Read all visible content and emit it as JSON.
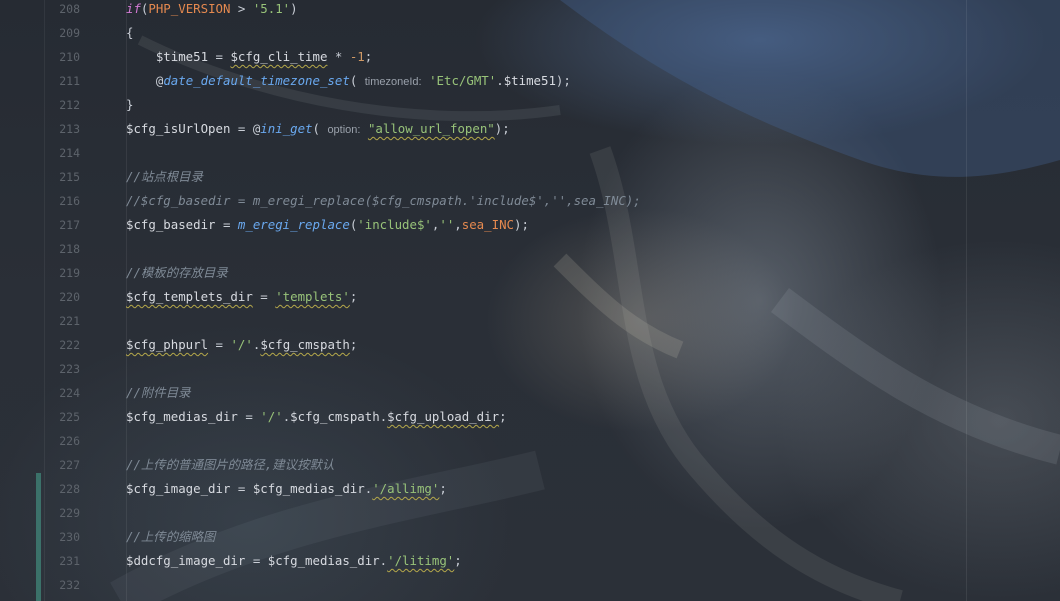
{
  "editor": {
    "accent_vcs_color": "#3e7c72",
    "lines": [
      {
        "num": "208",
        "segments": [
          {
            "t": "if",
            "c": "kw"
          },
          {
            "t": "(",
            "c": "op"
          },
          {
            "t": "PHP_VERSION",
            "c": "const"
          },
          {
            "t": " > ",
            "c": "op"
          },
          {
            "t": "'5.1'",
            "c": "str"
          },
          {
            "t": ")",
            "c": "op"
          }
        ]
      },
      {
        "num": "209",
        "segments": [
          {
            "t": "{",
            "c": "op"
          }
        ]
      },
      {
        "num": "210",
        "segments": [
          {
            "t": "    $time51",
            "c": "var"
          },
          {
            "t": " = ",
            "c": "op"
          },
          {
            "t": "$cfg_cli_time",
            "c": "var warn"
          },
          {
            "t": " * ",
            "c": "op"
          },
          {
            "t": "-1",
            "c": "num"
          },
          {
            "t": ";",
            "c": "op"
          }
        ]
      },
      {
        "num": "211",
        "segments": [
          {
            "t": "    @",
            "c": "op"
          },
          {
            "t": "date_default_timezone_set",
            "c": "fn"
          },
          {
            "t": "( ",
            "c": "op"
          },
          {
            "t": "timezoneId:",
            "c": "hint"
          },
          {
            "t": " ",
            "c": "op"
          },
          {
            "t": "'Etc/GMT'",
            "c": "str"
          },
          {
            "t": ".",
            "c": "op"
          },
          {
            "t": "$time51",
            "c": "var"
          },
          {
            "t": ");",
            "c": "op"
          }
        ]
      },
      {
        "num": "212",
        "segments": [
          {
            "t": "}",
            "c": "op"
          }
        ]
      },
      {
        "num": "213",
        "segments": [
          {
            "t": "$cfg_isUrlOpen",
            "c": "var"
          },
          {
            "t": " = ",
            "c": "op"
          },
          {
            "t": "@",
            "c": "op"
          },
          {
            "t": "ini_get",
            "c": "fn"
          },
          {
            "t": "( ",
            "c": "op"
          },
          {
            "t": "option:",
            "c": "hint"
          },
          {
            "t": " ",
            "c": "op"
          },
          {
            "t": "\"allow_url_fopen\"",
            "c": "str warn"
          },
          {
            "t": ");",
            "c": "op"
          }
        ]
      },
      {
        "num": "214",
        "segments": []
      },
      {
        "num": "215",
        "segments": [
          {
            "t": "//站点根目录",
            "c": "cm"
          }
        ]
      },
      {
        "num": "216",
        "segments": [
          {
            "t": "//$cfg_basedir = m_eregi_replace($cfg_cmspath.'include$','',sea_INC);",
            "c": "cm"
          }
        ]
      },
      {
        "num": "217",
        "segments": [
          {
            "t": "$cfg_basedir",
            "c": "var"
          },
          {
            "t": " = ",
            "c": "op"
          },
          {
            "t": "m_eregi_replace",
            "c": "fn"
          },
          {
            "t": "(",
            "c": "op"
          },
          {
            "t": "'include$'",
            "c": "str"
          },
          {
            "t": ",",
            "c": "op"
          },
          {
            "t": "''",
            "c": "str"
          },
          {
            "t": ",",
            "c": "op"
          },
          {
            "t": "sea_INC",
            "c": "const"
          },
          {
            "t": ");",
            "c": "op"
          }
        ]
      },
      {
        "num": "218",
        "segments": []
      },
      {
        "num": "219",
        "segments": [
          {
            "t": "//模板的存放目录",
            "c": "cm"
          }
        ]
      },
      {
        "num": "220",
        "segments": [
          {
            "t": "$cfg_templets_dir",
            "c": "var warn"
          },
          {
            "t": " = ",
            "c": "op"
          },
          {
            "t": "'templets'",
            "c": "str warn"
          },
          {
            "t": ";",
            "c": "op"
          }
        ]
      },
      {
        "num": "221",
        "segments": []
      },
      {
        "num": "222",
        "segments": [
          {
            "t": "$cfg_phpurl",
            "c": "var warn"
          },
          {
            "t": " = ",
            "c": "op"
          },
          {
            "t": "'/'",
            "c": "str"
          },
          {
            "t": ".",
            "c": "op"
          },
          {
            "t": "$cfg_cmspath",
            "c": "var warn"
          },
          {
            "t": ";",
            "c": "op"
          }
        ]
      },
      {
        "num": "223",
        "segments": []
      },
      {
        "num": "224",
        "segments": [
          {
            "t": "//附件目录",
            "c": "cm"
          }
        ]
      },
      {
        "num": "225",
        "segments": [
          {
            "t": "$cfg_medias_dir",
            "c": "var"
          },
          {
            "t": " = ",
            "c": "op"
          },
          {
            "t": "'/'",
            "c": "str"
          },
          {
            "t": ".",
            "c": "op"
          },
          {
            "t": "$cfg_cmspath",
            "c": "var"
          },
          {
            "t": ".",
            "c": "op"
          },
          {
            "t": "$cfg_upload_dir",
            "c": "var warn"
          },
          {
            "t": ";",
            "c": "op"
          }
        ]
      },
      {
        "num": "226",
        "segments": []
      },
      {
        "num": "227",
        "segments": [
          {
            "t": "//上传的普通图片的路径,建议按默认",
            "c": "cm"
          }
        ]
      },
      {
        "num": "228",
        "segments": [
          {
            "t": "$cfg_image_dir",
            "c": "var"
          },
          {
            "t": " = ",
            "c": "op"
          },
          {
            "t": "$cfg_medias_dir",
            "c": "var"
          },
          {
            "t": ".",
            "c": "op"
          },
          {
            "t": "'/allimg'",
            "c": "str warn"
          },
          {
            "t": ";",
            "c": "op"
          }
        ]
      },
      {
        "num": "229",
        "segments": []
      },
      {
        "num": "230",
        "segments": [
          {
            "t": "//上传的缩略图",
            "c": "cm"
          }
        ]
      },
      {
        "num": "231",
        "segments": [
          {
            "t": "$ddcfg_image_dir",
            "c": "var"
          },
          {
            "t": " = ",
            "c": "op"
          },
          {
            "t": "$cfg_medias_dir",
            "c": "var"
          },
          {
            "t": ".",
            "c": "op"
          },
          {
            "t": "'/litimg'",
            "c": "str warn"
          },
          {
            "t": ";",
            "c": "op"
          }
        ]
      },
      {
        "num": "232",
        "segments": []
      }
    ]
  }
}
